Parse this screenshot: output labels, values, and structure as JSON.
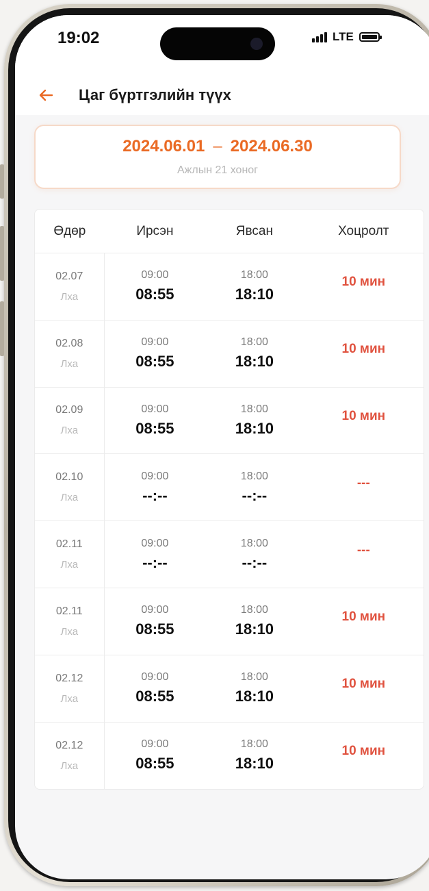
{
  "status_bar": {
    "time": "19:02",
    "network": "LTE"
  },
  "header": {
    "back_icon": "arrow-left-icon",
    "title": "Цаг бүртгэлийн түүх"
  },
  "period": {
    "start": "2024.06.01",
    "separator": "–",
    "end": "2024.06.30",
    "subtitle": "Ажлын 21 хоног"
  },
  "table": {
    "headers": [
      "Өдөр",
      "Ирсэн",
      "Явсан",
      "Хоцролт"
    ],
    "rows": [
      {
        "date": "02.07",
        "day": "Лха",
        "in_plan": "09:00",
        "in_actual": "08:55",
        "out_plan": "18:00",
        "out_actual": "18:10",
        "late": "10 мин"
      },
      {
        "date": "02.08",
        "day": "Лха",
        "in_plan": "09:00",
        "in_actual": "08:55",
        "out_plan": "18:00",
        "out_actual": "18:10",
        "late": "10 мин"
      },
      {
        "date": "02.09",
        "day": "Лха",
        "in_plan": "09:00",
        "in_actual": "08:55",
        "out_plan": "18:00",
        "out_actual": "18:10",
        "late": "10 мин"
      },
      {
        "date": "02.10",
        "day": "Лха",
        "in_plan": "09:00",
        "in_actual": "--:--",
        "out_plan": "18:00",
        "out_actual": "--:--",
        "late": "---"
      },
      {
        "date": "02.11",
        "day": "Лха",
        "in_plan": "09:00",
        "in_actual": "--:--",
        "out_plan": "18:00",
        "out_actual": "--:--",
        "late": "---"
      },
      {
        "date": "02.11",
        "day": "Лха",
        "in_plan": "09:00",
        "in_actual": "08:55",
        "out_plan": "18:00",
        "out_actual": "18:10",
        "late": "10 мин"
      },
      {
        "date": "02.12",
        "day": "Лха",
        "in_plan": "09:00",
        "in_actual": "08:55",
        "out_plan": "18:00",
        "out_actual": "18:10",
        "late": "10 мин"
      },
      {
        "date": "02.12",
        "day": "Лха",
        "in_plan": "09:00",
        "in_actual": "08:55",
        "out_plan": "18:00",
        "out_actual": "18:10",
        "late": "10 мин"
      }
    ]
  },
  "colors": {
    "accent": "#ea6a24",
    "late": "#e0523f"
  }
}
